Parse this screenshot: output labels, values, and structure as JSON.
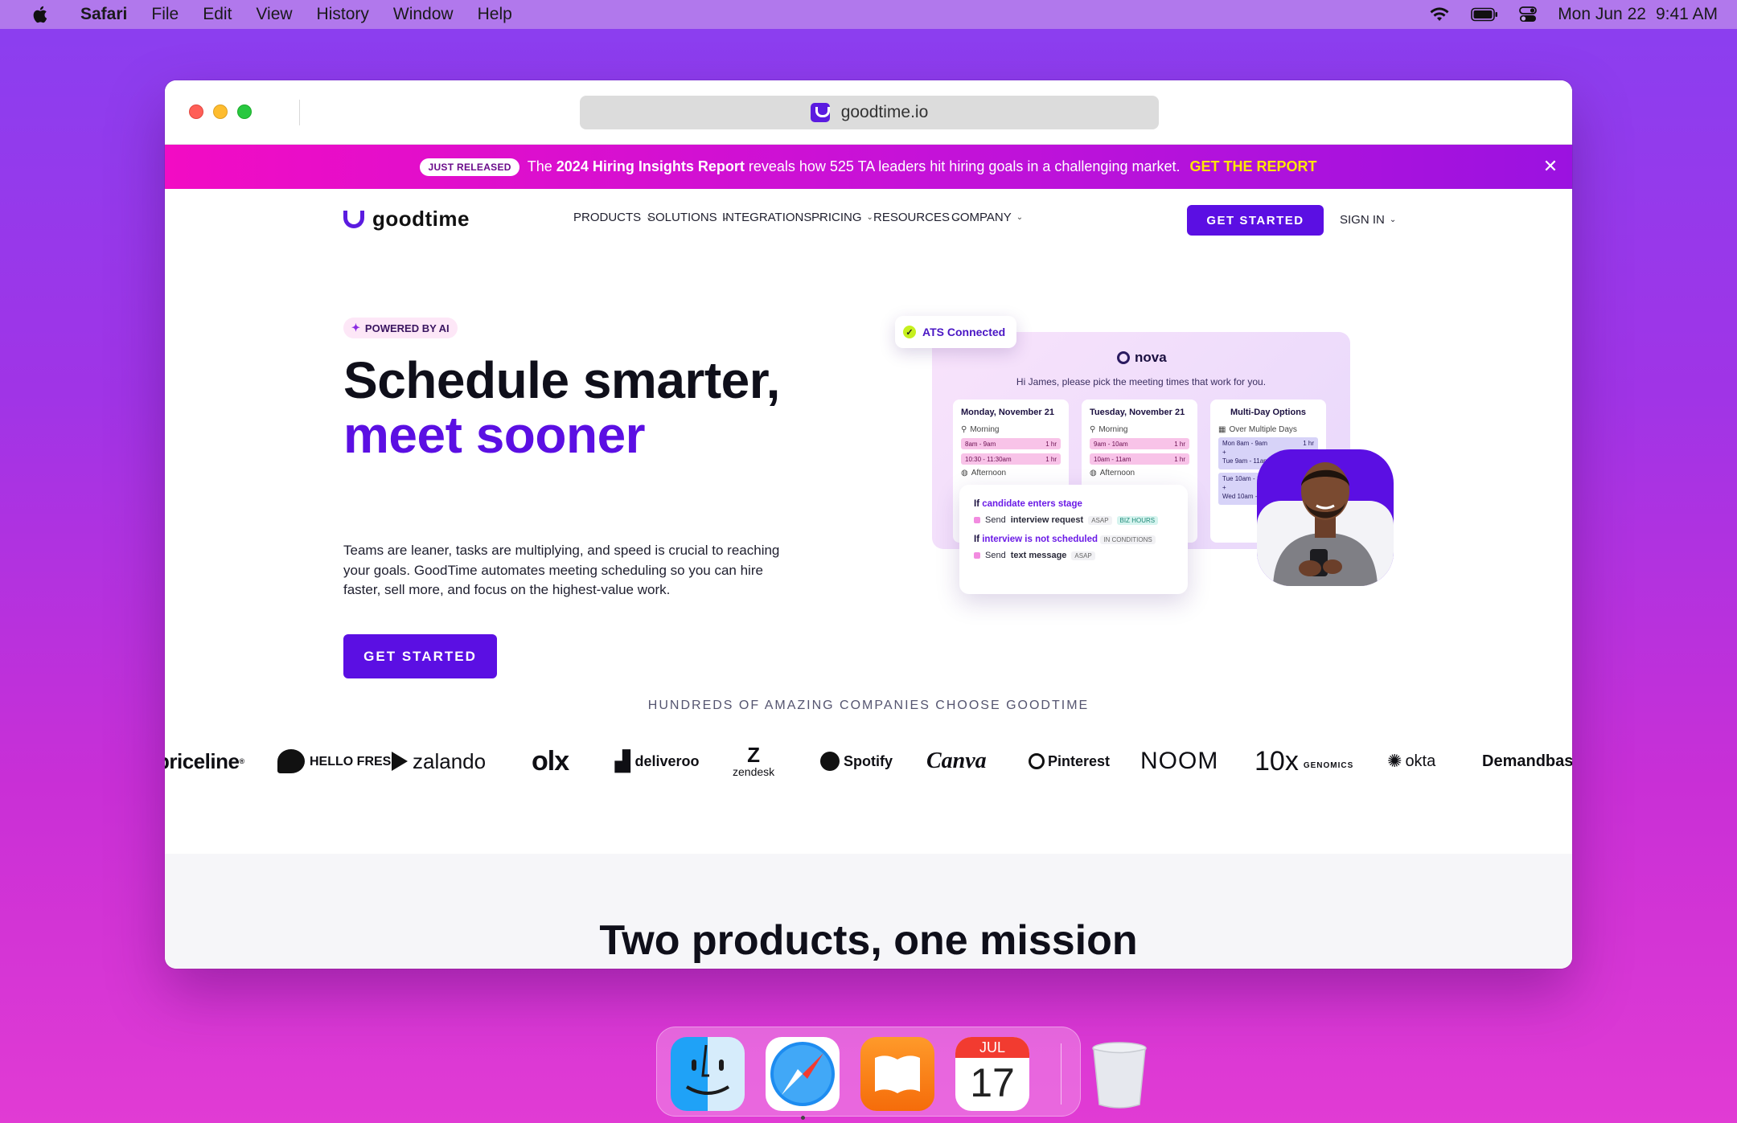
{
  "menubar": {
    "app": "Safari",
    "items": [
      "File",
      "Edit",
      "View",
      "History",
      "Window",
      "Help"
    ],
    "date": "Mon Jun 22",
    "time": "9:41 AM"
  },
  "browser": {
    "url": "goodtime.io"
  },
  "banner": {
    "pill": "JUST RELEASED",
    "text_pre": "The ",
    "text_bold": "2024 Hiring Insights Report",
    "text_post": " reveals how 525 TA leaders hit hiring goals in a challenging market.",
    "cta": "GET THE REPORT"
  },
  "nav": {
    "logo": "goodtime",
    "links": [
      "PRODUCTS",
      "SOLUTIONS",
      "INTEGRATIONS",
      "PRICING",
      "RESOURCES",
      "COMPANY"
    ],
    "cta": "GET STARTED",
    "signin": "SIGN IN"
  },
  "hero": {
    "pill": "POWERED BY AI",
    "title_line1": "Schedule smarter,",
    "title_line2": "meet sooner",
    "lede": "Teams are leaner, tasks are multiplying, and speed is crucial to reaching your goals. GoodTime automates meeting scheduling so you can hire faster, sell more, and focus on the highest-value work.",
    "cta": "GET STARTED"
  },
  "illustration": {
    "ats_badge": "ATS Connected",
    "nova_title": "nova",
    "nova_sub": "Hi James, please pick the meeting times that work for you.",
    "days": [
      {
        "title": "Monday, November 21",
        "morning": "Morning",
        "slots": [
          {
            "t": "8am - 9am",
            "d": "1 hr"
          },
          {
            "t": "10:30 - 11:30am",
            "d": "1 hr"
          }
        ],
        "afternoon": "Afternoon"
      },
      {
        "title": "Tuesday, November 21",
        "morning": "Morning",
        "slots": [
          {
            "t": "9am - 10am",
            "d": "1 hr"
          },
          {
            "t": "10am - 11am",
            "d": "1 hr"
          }
        ],
        "afternoon": "Afternoon"
      }
    ],
    "multi": {
      "title": "Multi-Day Options",
      "label": "Over Multiple Days",
      "opt1": [
        "Mon  8am - 9am",
        "1 hr",
        "+",
        "Tue  9am - 11am"
      ],
      "opt2": [
        "Tue  10am - 11am",
        "+",
        "Wed  10am - 11am"
      ]
    },
    "rules": [
      {
        "if": "If",
        "cond": "candidate enters stage",
        "send": "Send",
        "action": "interview request",
        "tags": [
          "ASAP",
          "BIZ HOURS"
        ]
      },
      {
        "if": "If",
        "cond": "interview is not scheduled",
        "tag": "IN CONDITIONS",
        "send": "Send",
        "action": "text message",
        "tags": [
          "ASAP"
        ]
      }
    ]
  },
  "logos": {
    "heading": "HUNDREDS OF AMAZING COMPANIES CHOOSE GOODTIME",
    "items": [
      "priceline",
      "HELLO FRESH",
      "zalando",
      "olx",
      "deliveroo",
      "zendesk",
      "Spotify",
      "Canva",
      "Pinterest",
      "NOOM",
      "10x",
      "okta",
      "Demandbase"
    ],
    "tenx_sub": "GENOMICS"
  },
  "section2": {
    "title": "Two products, one mission"
  },
  "dock": {
    "calendar_month": "JUL",
    "calendar_day": "17"
  },
  "colors": {
    "brand": "#5b0fe3",
    "banner_cta": "#ffe600",
    "banner_start": "#f20cc4"
  }
}
